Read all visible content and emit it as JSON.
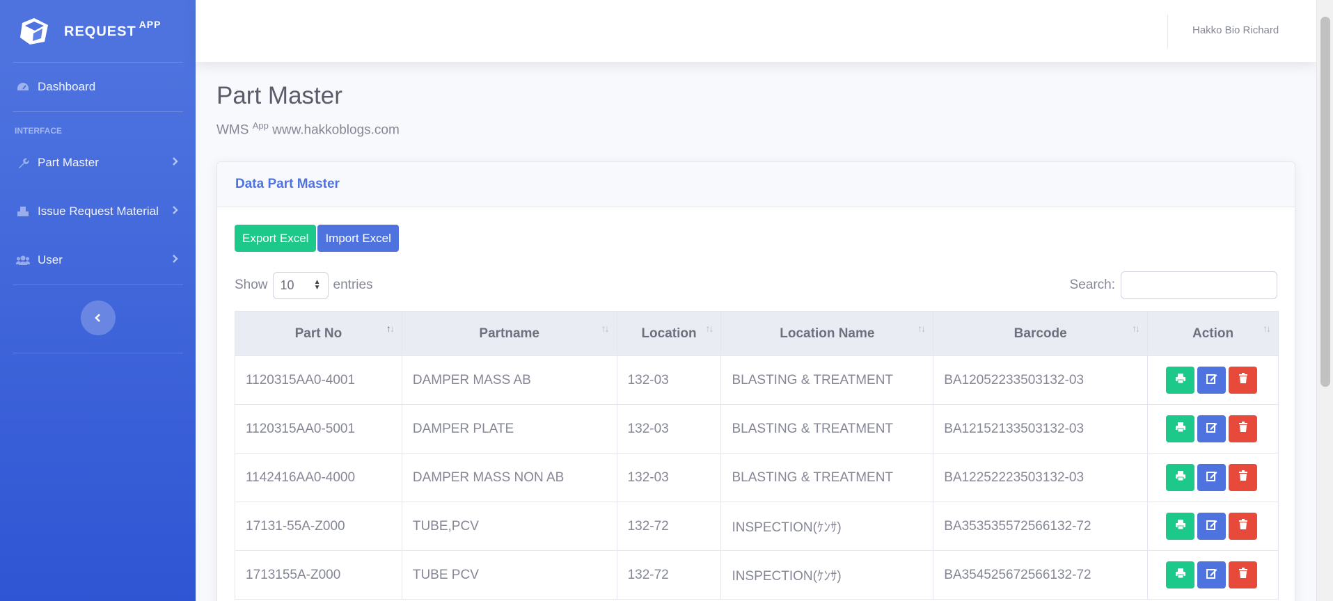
{
  "brand": {
    "name": "REQUEST",
    "sup": "APP"
  },
  "sidebar": {
    "dashboard": "Dashboard",
    "heading": "INTERFACE",
    "items": [
      {
        "label": "Part Master"
      },
      {
        "label": "Issue Request Material"
      },
      {
        "label": "User"
      }
    ]
  },
  "topbar": {
    "user": "Hakko Bio Richard"
  },
  "page": {
    "title": "Part Master",
    "sub_prefix": "WMS",
    "sub_sup": "App",
    "sub_site": "www.hakkoblogs.com"
  },
  "card": {
    "title": "Data Part Master"
  },
  "buttons": {
    "export": "Export Excel",
    "import": "Import Excel"
  },
  "controls": {
    "show": "Show",
    "entries_value": "10",
    "entries": "entries",
    "search_label": "Search:"
  },
  "table": {
    "headers": [
      "Part No",
      "Partname",
      "Location",
      "Location Name",
      "Barcode",
      "Action"
    ],
    "rows": [
      [
        "1120315AA0-4001",
        "DAMPER MASS AB",
        "132-03",
        "BLASTING & TREATMENT",
        "BA12052233503132-03"
      ],
      [
        "1120315AA0-5001",
        "DAMPER PLATE",
        "132-03",
        "BLASTING & TREATMENT",
        "BA12152133503132-03"
      ],
      [
        "1142416AA0-4000",
        "DAMPER MASS NON AB",
        "132-03",
        "BLASTING & TREATMENT",
        "BA12252223503132-03"
      ],
      [
        "17131-55A-Z000",
        "TUBE,PCV",
        "132-72",
        "INSPECTION(ｹﾝｻ)",
        "BA353535572566132-72"
      ],
      [
        "1713155A-Z000",
        "TUBE PCV",
        "132-72",
        "INSPECTION(ｹﾝｻ)",
        "BA354525672566132-72"
      ]
    ]
  },
  "colors": {
    "primary": "#4e73df",
    "success": "#1cc88a",
    "danger": "#e74a3b"
  },
  "icons": {
    "brand": "box-icon",
    "dashboard": "tachometer-icon",
    "part_master": "wrench-icon",
    "issue": "cubes-icon",
    "user": "users-icon",
    "print": "print-icon",
    "edit": "edit-icon",
    "delete": "trash-icon"
  }
}
